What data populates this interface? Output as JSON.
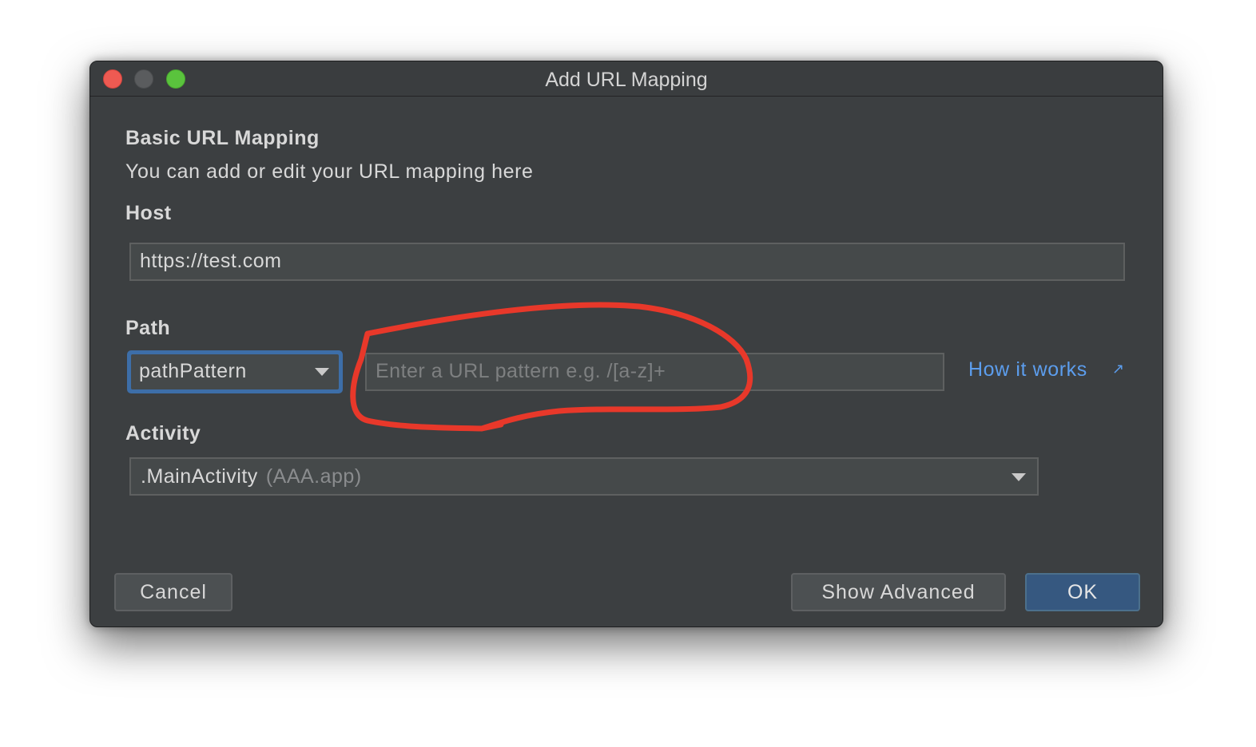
{
  "window": {
    "title": "Add URL Mapping"
  },
  "section": {
    "heading": "Basic URL Mapping",
    "description": "You can add or edit your URL mapping here"
  },
  "host": {
    "label": "Host",
    "value": "https://test.com"
  },
  "path": {
    "label": "Path",
    "mode_selected": "pathPattern",
    "pattern_placeholder": "Enter a URL pattern e.g. /[a-z]+",
    "pattern_value": "",
    "help_link": "How it works",
    "help_link_icon": "external-link-arrow-icon"
  },
  "activity": {
    "label": "Activity",
    "selected_name": ".MainActivity",
    "selected_module": "(AAA.app)"
  },
  "buttons": {
    "cancel": "Cancel",
    "show_advanced": "Show Advanced",
    "ok": "OK"
  },
  "colors": {
    "dialog_bg": "#3c3f41",
    "field_bg": "#45494a",
    "focus_accent": "#3d6ea8",
    "link": "#5c9ded",
    "primary_button": "#365880",
    "annotation_stroke": "#e8382a"
  }
}
